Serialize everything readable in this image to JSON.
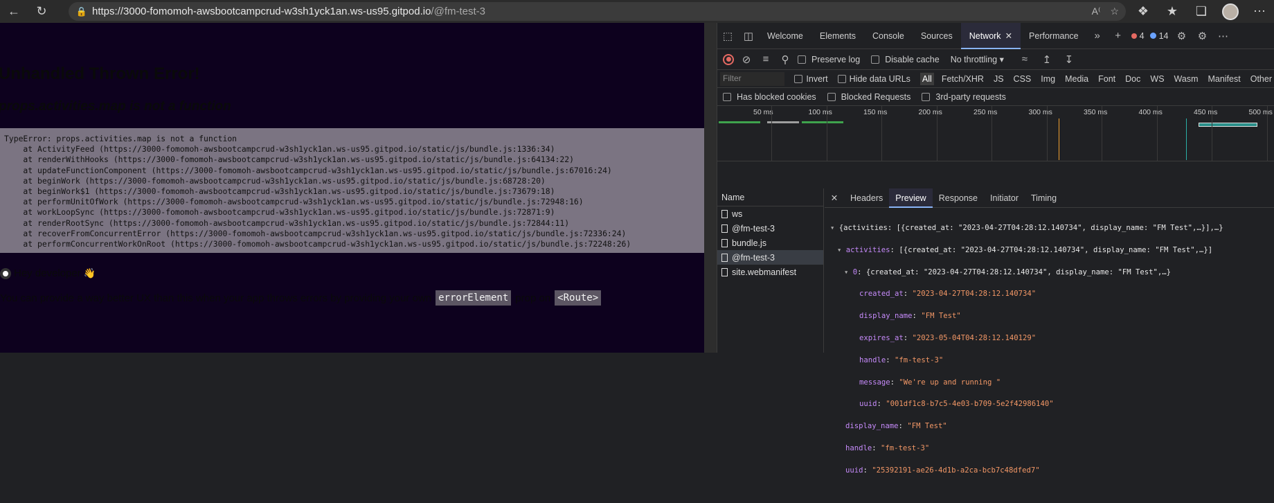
{
  "browser": {
    "url_host": "https://3000-fomomoh-awsbootcampcrud-w3sh1yck1an.ws-us95.gitpod.io",
    "url_path": "/@fm-test-3"
  },
  "page": {
    "error_title": "Unhandled Thrown Error!",
    "error_message": "props.activities.map is not a function",
    "stack_trace": "TypeError: props.activities.map is not a function\n    at ActivityFeed (https://3000-fomomoh-awsbootcampcrud-w3sh1yck1an.ws-us95.gitpod.io/static/js/bundle.js:1336:34)\n    at renderWithHooks (https://3000-fomomoh-awsbootcampcrud-w3sh1yck1an.ws-us95.gitpod.io/static/js/bundle.js:64134:22)\n    at updateFunctionComponent (https://3000-fomomoh-awsbootcampcrud-w3sh1yck1an.ws-us95.gitpod.io/static/js/bundle.js:67016:24)\n    at beginWork (https://3000-fomomoh-awsbootcampcrud-w3sh1yck1an.ws-us95.gitpod.io/static/js/bundle.js:68728:20)\n    at beginWork$1 (https://3000-fomomoh-awsbootcampcrud-w3sh1yck1an.ws-us95.gitpod.io/static/js/bundle.js:73679:18)\n    at performUnitOfWork (https://3000-fomomoh-awsbootcampcrud-w3sh1yck1an.ws-us95.gitpod.io/static/js/bundle.js:72948:16)\n    at workLoopSync (https://3000-fomomoh-awsbootcampcrud-w3sh1yck1an.ws-us95.gitpod.io/static/js/bundle.js:72871:9)\n    at renderRootSync (https://3000-fomomoh-awsbootcampcrud-w3sh1yck1an.ws-us95.gitpod.io/static/js/bundle.js:72844:11)\n    at recoverFromConcurrentError (https://3000-fomomoh-awsbootcampcrud-w3sh1yck1an.ws-us95.gitpod.io/static/js/bundle.js:72336:24)\n    at performConcurrentWorkOnRoot (https://3000-fomomoh-awsbootcampcrud-w3sh1yck1an.ws-us95.gitpod.io/static/js/bundle.js:72248:26)",
    "hey_developer": "Hey developer",
    "hey_emoji": "👋",
    "hint_before": "You can provide a way better UX than this when your app throws errors by providing your own",
    "hint_code1": "errorElement",
    "hint_middle": "prop on",
    "hint_code2": "<Route>"
  },
  "devtools": {
    "tabs": [
      "Welcome",
      "Elements",
      "Console",
      "Sources",
      "Network",
      "Performance"
    ],
    "error_count": "4",
    "info_count": "14",
    "toolbar": {
      "preserve_log": "Preserve log",
      "disable_cache": "Disable cache",
      "throttling": "No throttling"
    },
    "filter": {
      "placeholder": "Filter",
      "invert": "Invert",
      "hide_data_urls": "Hide data URLs",
      "types": [
        "All",
        "Fetch/XHR",
        "JS",
        "CSS",
        "Img",
        "Media",
        "Font",
        "Doc",
        "WS",
        "Wasm",
        "Manifest",
        "Other"
      ]
    },
    "blocked": {
      "has_blocked_cookies": "Has blocked cookies",
      "blocked_requests": "Blocked Requests",
      "third_party": "3rd-party requests"
    },
    "timeline_labels": [
      "50 ms",
      "100 ms",
      "150 ms",
      "200 ms",
      "250 ms",
      "300 ms",
      "350 ms",
      "400 ms",
      "450 ms",
      "500 ms"
    ],
    "name_header": "Name",
    "requests": [
      "ws",
      "@fm-test-3",
      "bundle.js",
      "@fm-test-3",
      "site.webmanifest"
    ],
    "detail_tabs": [
      "Headers",
      "Preview",
      "Response",
      "Initiator",
      "Timing"
    ],
    "preview": {
      "root": "{activities: [{created_at: \"2023-04-27T04:28:12.140734\", display_name: \"FM Test\",…}],…}",
      "activities_key": "activities",
      "activities_val": "[{created_at: \"2023-04-27T04:28:12.140734\", display_name: \"FM Test\",…}]",
      "item0_key": "0",
      "item0_val": "{created_at: \"2023-04-27T04:28:12.140734\", display_name: \"FM Test\",…}",
      "fields": [
        {
          "k": "created_at",
          "v": "\"2023-04-27T04:28:12.140734\""
        },
        {
          "k": "display_name",
          "v": "\"FM Test\""
        },
        {
          "k": "expires_at",
          "v": "\"2023-05-04T04:28:12.140129\""
        },
        {
          "k": "handle",
          "v": "\"fm-test-3\""
        },
        {
          "k": "message",
          "v": "\"We're up and running \""
        },
        {
          "k": "uuid",
          "v": "\"001df1c8-b7c5-4e03-b709-5e2f42986140\""
        }
      ],
      "top_fields": [
        {
          "k": "display_name",
          "v": "\"FM Test\""
        },
        {
          "k": "handle",
          "v": "\"fm-test-3\""
        },
        {
          "k": "uuid",
          "v": "\"25392191-ae26-4d1b-a2ca-bcb7c48dfed7\""
        }
      ]
    }
  }
}
